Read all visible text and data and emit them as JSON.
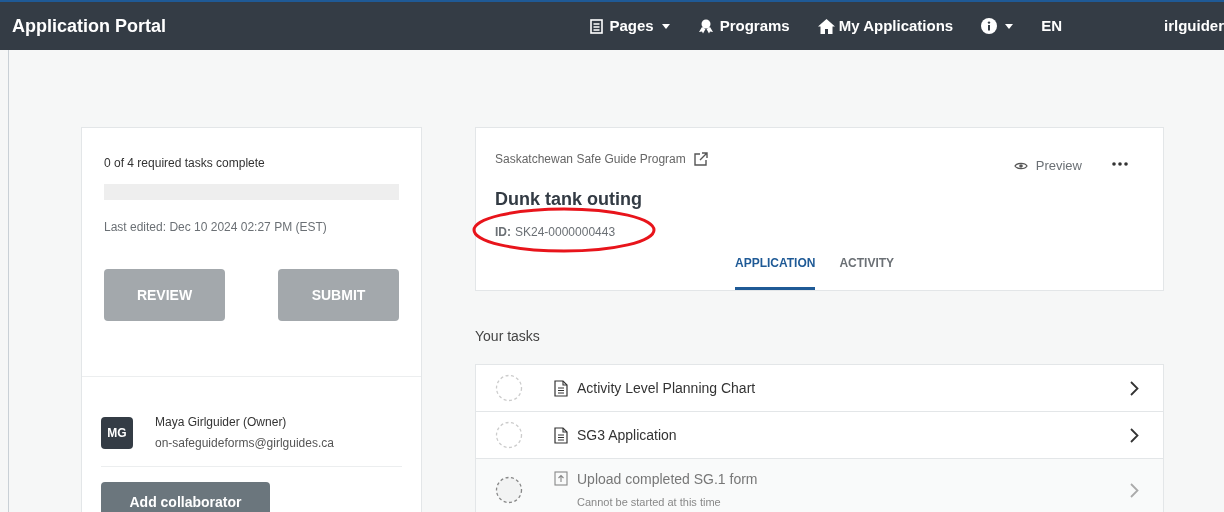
{
  "navbar": {
    "title": "Application Portal",
    "items": [
      {
        "label": "Pages",
        "kind": "pages",
        "dropdown": true
      },
      {
        "label": "Programs",
        "kind": "programs",
        "dropdown": false
      },
      {
        "label": "My Applications",
        "kind": "home",
        "dropdown": false
      },
      {
        "kind": "info",
        "dropdown": true
      },
      {
        "label": "EN",
        "kind": "text",
        "dropdown": false
      }
    ],
    "user": "irlguider"
  },
  "summary": {
    "progress_text": "0 of 4 required tasks complete",
    "level": 0,
    "last_edited": "Last edited: Dec 10 2024 02:27 PM (EST)",
    "buttons": [
      {
        "label": "REVIEW",
        "disabled": true
      },
      {
        "label": "SUBMIT",
        "disabled": true
      }
    ]
  },
  "collaborators": [
    {
      "initials": "MG",
      "name": "Maya Girlguider (Owner)",
      "email": "on-safeguideforms@girlguides.ca"
    }
  ],
  "add_button": "Add collaborator",
  "application": {
    "program": "Saskatchewan Safe Guide Program",
    "title": "Dunk tank outing",
    "id_label": "ID:",
    "id_value": "SK24-0000000443",
    "id_circled": true,
    "preview": "Preview",
    "tabs": [
      {
        "label": "APPLICATION",
        "selected": true
      },
      {
        "label": "ACTIVITY",
        "selected": false
      }
    ]
  },
  "tasks_heading": "Your tasks",
  "tasks": [
    {
      "kind": "form",
      "title": "Activity Level Planning Chart",
      "disabled": false
    },
    {
      "kind": "form",
      "title": "SG3 Application",
      "disabled": false
    },
    {
      "kind": "upload",
      "title": "Upload completed SG.1 form",
      "note": "Cannot be started at this time",
      "disabled": true
    }
  ]
}
